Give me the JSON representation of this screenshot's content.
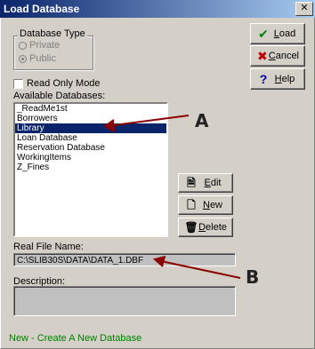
{
  "window": {
    "title": "Load Database",
    "close_symbol": "✕"
  },
  "database_type": {
    "label": "Database Type",
    "options": [
      {
        "label": "Private",
        "checked": false
      },
      {
        "label": "Public",
        "checked": true
      }
    ]
  },
  "read_only": {
    "label": "Read Only Mode",
    "checked": false
  },
  "databases": {
    "label": "Available Databases:",
    "items": [
      "_ReadMe1st",
      "Borrowers",
      "Library",
      "Loan Database",
      "Reservation Database",
      "WorkingItems",
      "Z_Fines"
    ],
    "selected_index": 2
  },
  "buttons": {
    "load": "Load",
    "cancel": "Cancel",
    "help": "Help",
    "edit": "Edit",
    "new": "New",
    "delete": "Delete"
  },
  "file": {
    "label": "Real File Name:",
    "value": "C:\\SLIB30S\\DATA\\DATA_1.DBF"
  },
  "description": {
    "label": "Description:",
    "value": ""
  },
  "status": {
    "text": "New - Create A New Database"
  },
  "annotations": {
    "a": "A",
    "b": "B"
  },
  "colors": {
    "selection": "#0a246a",
    "status": "#008000",
    "arrow": "#8b0000"
  }
}
